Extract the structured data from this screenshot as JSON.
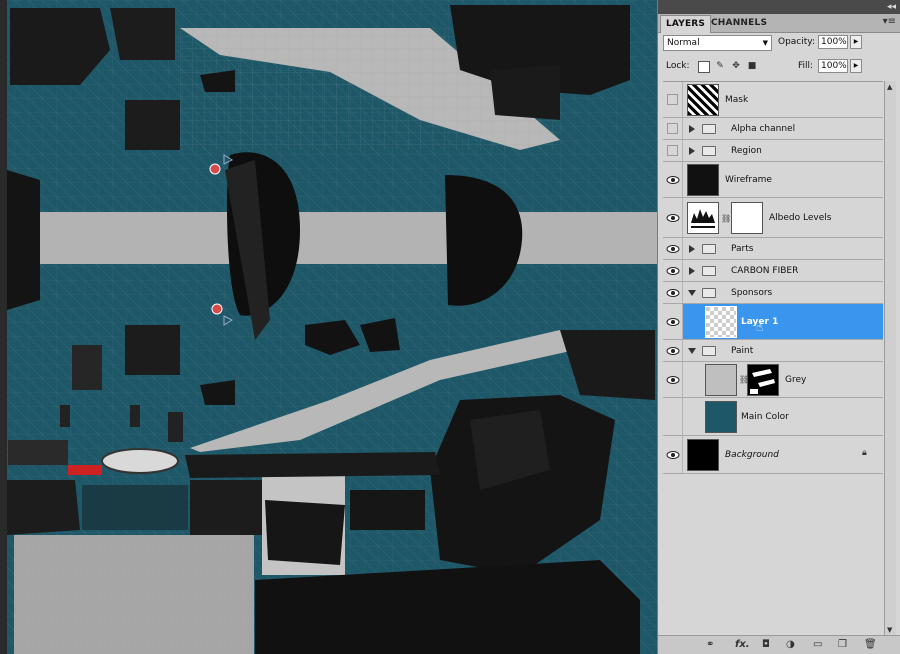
{
  "panel": {
    "tabs": [
      {
        "label": "LAYERS",
        "active": true
      },
      {
        "label": "CHANNELS",
        "active": false
      }
    ],
    "blend_mode": "Normal",
    "opacity_label": "Opacity:",
    "opacity_value": "100%",
    "lock_label": "Lock:",
    "fill_label": "Fill:",
    "fill_value": "100%"
  },
  "layers": [
    {
      "name": "Mask",
      "visible": false,
      "type": "layer",
      "thumb": "mask"
    },
    {
      "name": "Alpha channel",
      "visible": false,
      "type": "group",
      "expanded": false
    },
    {
      "name": "Region",
      "visible": false,
      "type": "group",
      "expanded": false
    },
    {
      "name": "Wireframe",
      "visible": true,
      "type": "layer",
      "thumb": "wire"
    },
    {
      "name": "Albedo Levels",
      "visible": true,
      "type": "adjustment"
    },
    {
      "name": "Parts",
      "visible": true,
      "type": "group",
      "expanded": false
    },
    {
      "name": "CARBON FIBER",
      "visible": true,
      "type": "group",
      "expanded": false
    },
    {
      "name": "Sponsors",
      "visible": true,
      "type": "group",
      "expanded": true
    },
    {
      "name": "Layer 1",
      "visible": true,
      "type": "layer",
      "selected": true,
      "thumb": "transparent"
    },
    {
      "name": "Paint",
      "visible": true,
      "type": "group",
      "expanded": true
    },
    {
      "name": "Grey",
      "visible": true,
      "type": "layer",
      "thumb": "grey"
    },
    {
      "name": "Main Color",
      "visible": true,
      "type": "layer",
      "thumb": "teal"
    },
    {
      "name": "Background",
      "visible": true,
      "type": "layer",
      "thumb": "black",
      "locked": true
    }
  ],
  "colors": {
    "canvas_teal": "#1e5868",
    "selection_blue": "#3a95ee",
    "panel_grey": "#d6d6d6"
  }
}
